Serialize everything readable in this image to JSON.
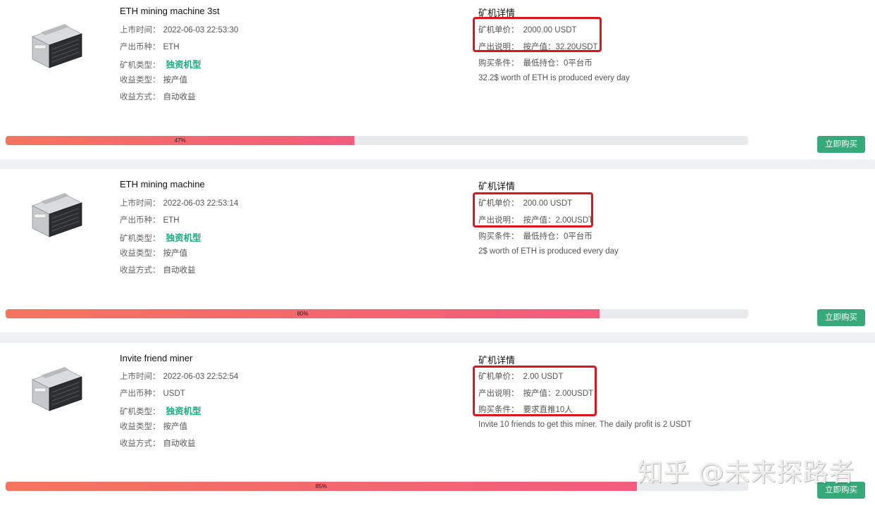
{
  "labels": {
    "listing_time": "上市时间：",
    "coin": "产出币种：",
    "miner_type": "矿机类型：",
    "income_type": "收益类型：",
    "income_method": "收益方式：",
    "detail_title": "矿机详情",
    "unit_price": "矿机单价：",
    "output_desc": "产出说明：",
    "buy_condition": "购买条件：",
    "buy_button": "立即购买"
  },
  "cards": [
    {
      "name": "ETH mining machine 3st",
      "listing_time": "2022-06-03 22:53:30",
      "coin": "ETH",
      "miner_type": "独资机型",
      "income_type": "按产值",
      "income_method": "自动收益",
      "unit_price": "2000.00 USDT",
      "output_desc": "按产值：32.20USDT",
      "buy_condition": "最低持仓：0平台币",
      "description": "32.2$ worth of ETH is produced every day",
      "progress": 47,
      "progress_label": "47%"
    },
    {
      "name": "ETH mining machine",
      "listing_time": "2022-06-03 22:53:14",
      "coin": "ETH",
      "miner_type": "独资机型",
      "income_type": "按产值",
      "income_method": "自动收益",
      "unit_price": "200.00 USDT",
      "output_desc": "按产值：2.00USDT",
      "buy_condition": "最低持仓：0平台币",
      "description": "2$ worth of ETH is produced every day",
      "progress": 80,
      "progress_label": "80%"
    },
    {
      "name": "Invite friend miner",
      "listing_time": "2022-06-03 22:52:54",
      "coin": "USDT",
      "miner_type": "独资机型",
      "income_type": "按产值",
      "income_method": "自动收益",
      "unit_price": "2.00 USDT",
      "output_desc": "按产值：2.00USDT",
      "buy_condition": "要求直推10人",
      "description": "Invite 10 friends to get this miner. The daily profit is 2 USDT",
      "progress": 85,
      "progress_label": "85%"
    }
  ],
  "watermark": "知乎 @未来探路者",
  "colors": {
    "accent_green": "#1aab80",
    "button_green": "#35aa78",
    "highlight_red": "#e0141c",
    "progress_start": "#f3755e",
    "progress_end": "#f25c7e"
  }
}
